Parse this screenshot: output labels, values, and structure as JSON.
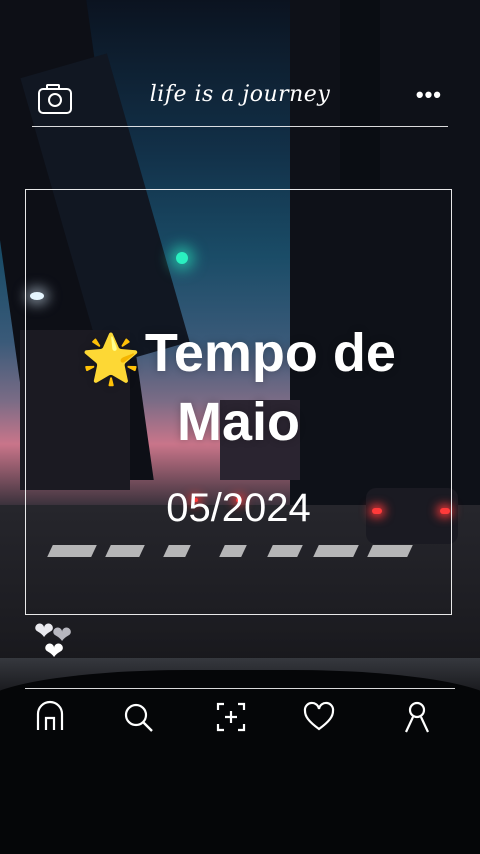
{
  "header": {
    "title": "life is a journey",
    "camera_icon": "camera-icon",
    "more_icon": "more-horizontal-icon",
    "more_glyph": "•••"
  },
  "card": {
    "star_glyph": "🌟",
    "headline": "Tempo de Maio",
    "date": "05/2024"
  },
  "reactions": {
    "icon": "hearts-icon"
  },
  "bottom_nav": [
    {
      "name": "home",
      "icon": "home-icon"
    },
    {
      "name": "search",
      "icon": "search-icon"
    },
    {
      "name": "add",
      "icon": "add-icon"
    },
    {
      "name": "likes",
      "icon": "heart-icon"
    },
    {
      "name": "profile",
      "icon": "profile-icon"
    }
  ],
  "colors": {
    "foreground": "#ffffff",
    "accent_star": "#ffd23f",
    "taillight": "#ff3a3a",
    "traffic_light": "#2af0c0"
  }
}
